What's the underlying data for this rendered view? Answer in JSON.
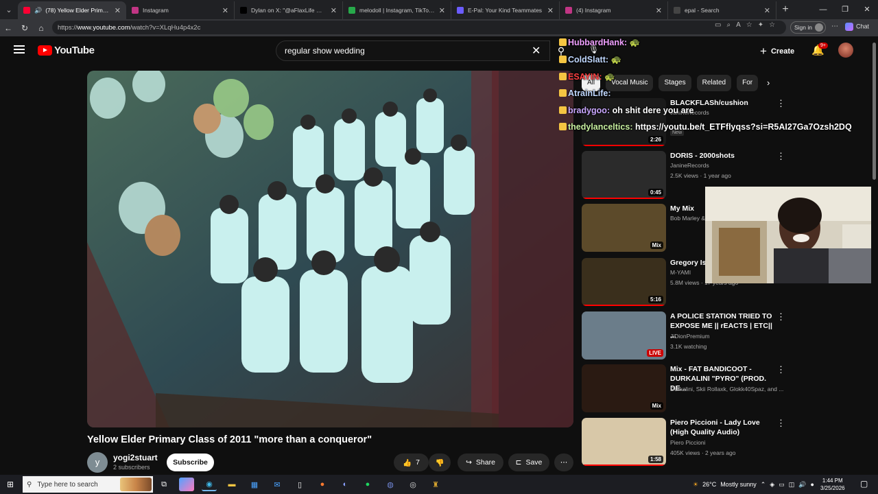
{
  "browser": {
    "tabs": [
      {
        "title": "(78) Yellow Elder Primary Clas",
        "favicon_color": "#ff0033",
        "active": true,
        "icon": "speaker-icon"
      },
      {
        "title": "Instagram",
        "favicon_color": "#c13584",
        "active": false
      },
      {
        "title": "Dylan on X: \"@aFlaxLife @Marky",
        "favicon_color": "#000000",
        "active": false
      },
      {
        "title": "melodoll | Instagram, TikTok, Twit",
        "favicon_color": "#27a94a",
        "active": false
      },
      {
        "title": "E-Pal: Your Kind Teammates",
        "favicon_color": "#6b5cff",
        "active": false
      },
      {
        "title": "(4) Instagram",
        "favicon_color": "#c13584",
        "active": false
      },
      {
        "title": "epal - Search",
        "favicon_color": "#444444",
        "active": false
      }
    ],
    "url_prefix": "https://",
    "url_domain": "www.youtube.com",
    "url_path": "/watch?v=XLqHu4p4x2c",
    "sign_in_label": "Sign in",
    "chat_label": "Chat"
  },
  "youtube": {
    "logo_text": "YouTube",
    "search_value": "regular show wedding",
    "create_label": "Create",
    "notification_count": "9+"
  },
  "video": {
    "title": "Yellow Elder Primary Class of 2011 \"more than a conqueror\"",
    "channel_initial": "y",
    "channel_name": "yogi2stuart",
    "subscribers": "2 subscribers",
    "subscribe_label": "Subscribe",
    "likes": "7",
    "share_label": "Share",
    "save_label": "Save"
  },
  "chips": [
    "All",
    "Vocal Music",
    "Stages",
    "Related",
    "For"
  ],
  "recommendations": [
    {
      "title": "BLACKFLASh/cushion",
      "channel": "JanineRecords",
      "meta": "",
      "badge": "New",
      "duration": "2:26",
      "thumb": "#1a1a1a",
      "progress": 1.0
    },
    {
      "title": "DORIS - 2000shots",
      "channel": "JanineRecords",
      "meta": "2.5K views · 1 year ago",
      "badge": "",
      "duration": "0:45",
      "thumb": "#2b2b2b",
      "progress": 1.0
    },
    {
      "title": "My Mix",
      "channel": "Bob Marley &",
      "meta": "",
      "badge": "",
      "duration": "Mix",
      "thumb": "#5c4a2a",
      "progress": 0
    },
    {
      "title": "Gregory Isa Pace",
      "channel": "M-YAMI",
      "meta": "5.8M views · 17 years ago",
      "badge": "",
      "duration": "5:16",
      "thumb": "#3a2f1c",
      "progress": 1.0
    },
    {
      "title": "A POLICE STATION TRIED TO EXPOSE ME || rEACTS | ETC|| ...",
      "channel": "JiDionPremium",
      "meta": "3.1K watching",
      "badge": "",
      "duration": "LIVE",
      "thumb": "#6b7d8a",
      "progress": 0
    },
    {
      "title": "Mix - FAT BANDICOOT - DURKALINI \"PYRO\" (PROD. DE...",
      "channel": "Durkalini, Skii Rollaxk, Glokk40Spaz, and ...",
      "meta": "",
      "badge": "",
      "duration": "Mix",
      "thumb": "#2a1a12",
      "progress": 0
    },
    {
      "title": "Piero Piccioni - Lady Love (High Quality Audio)",
      "channel": "Piero Piccioni",
      "meta": "405K views · 2 years ago",
      "badge": "",
      "duration": "1:58",
      "thumb": "#d8c8a8",
      "progress": 1.0
    }
  ],
  "stream_chat": [
    {
      "user": "HubbardHank:",
      "color": "#f0a0ff",
      "msg": "🐢"
    },
    {
      "user": "ColdSlatt:",
      "color": "#c0d8ff",
      "msg": "🐢"
    },
    {
      "user": "ESAYIN:",
      "color": "#ff4040",
      "msg": "🐢"
    },
    {
      "user": "AtrainLife:",
      "color": "#c0d8ff",
      "msg": ""
    },
    {
      "user": "bradygoo:",
      "color": "#c9a7ff",
      "msg": "oh shit dere you are"
    },
    {
      "user": "thedylanceltics:",
      "color": "#c8f0a0",
      "msg": "https://youtu.be/t_ETFflyqss?si=R5AI27Ga7Ozsh2DQ"
    }
  ],
  "taskbar": {
    "search_placeholder": "Type here to search",
    "temperature": "26°C",
    "weather": "Mostly sunny",
    "time": "1:44 PM",
    "date": "3/25/2026"
  }
}
